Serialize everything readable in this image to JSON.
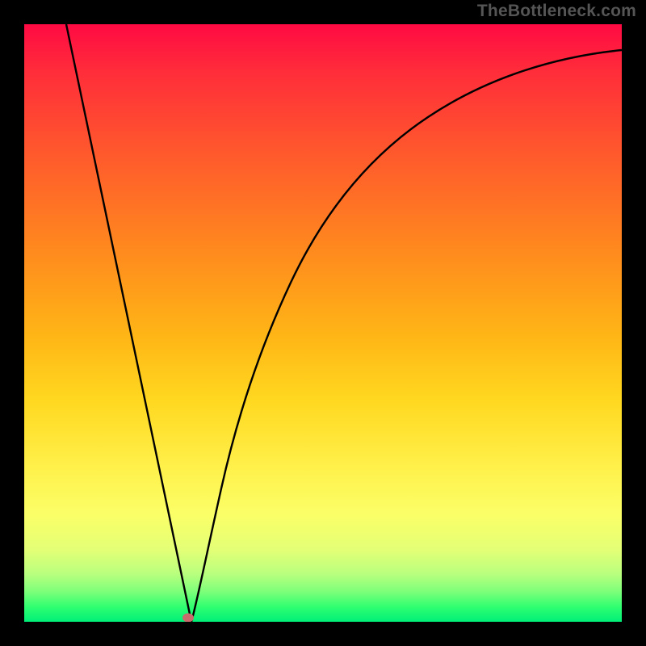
{
  "attribution": "TheBottleneck.com",
  "colors": {
    "page_bg": "#000000",
    "attribution_text": "#555555",
    "curve_stroke": "#000000",
    "marker_fill": "#c96a6c"
  },
  "chart_data": {
    "type": "line",
    "title": "",
    "xlabel": "",
    "ylabel": "",
    "xlim": [
      0,
      100
    ],
    "ylim": [
      0,
      100
    ],
    "grid": false,
    "legend": false,
    "series": [
      {
        "name": "left-branch",
        "x": [
          7,
          10,
          14,
          18,
          22,
          26,
          28
        ],
        "values": [
          100,
          85,
          65,
          45,
          25,
          6,
          0
        ]
      },
      {
        "name": "right-branch",
        "x": [
          28,
          30,
          33,
          36,
          40,
          45,
          50,
          56,
          63,
          72,
          82,
          92,
          100
        ],
        "values": [
          0,
          8,
          22,
          34,
          46,
          57,
          65,
          72,
          78,
          83,
          87,
          89.5,
          91
        ]
      }
    ],
    "marker": {
      "x": 27.5,
      "y": 0.7
    },
    "background_gradient_stops": [
      {
        "pos": 0,
        "color": "#ff0a43"
      },
      {
        "pos": 8,
        "color": "#ff2d3a"
      },
      {
        "pos": 22,
        "color": "#ff5a2c"
      },
      {
        "pos": 38,
        "color": "#ff8a1e"
      },
      {
        "pos": 52,
        "color": "#ffb516"
      },
      {
        "pos": 63,
        "color": "#ffd820"
      },
      {
        "pos": 74,
        "color": "#fff04a"
      },
      {
        "pos": 82,
        "color": "#fbff67"
      },
      {
        "pos": 88,
        "color": "#e3ff76"
      },
      {
        "pos": 92,
        "color": "#b9ff7e"
      },
      {
        "pos": 95,
        "color": "#7cff7a"
      },
      {
        "pos": 97.5,
        "color": "#2fff70"
      },
      {
        "pos": 100,
        "color": "#00ef78"
      }
    ]
  }
}
